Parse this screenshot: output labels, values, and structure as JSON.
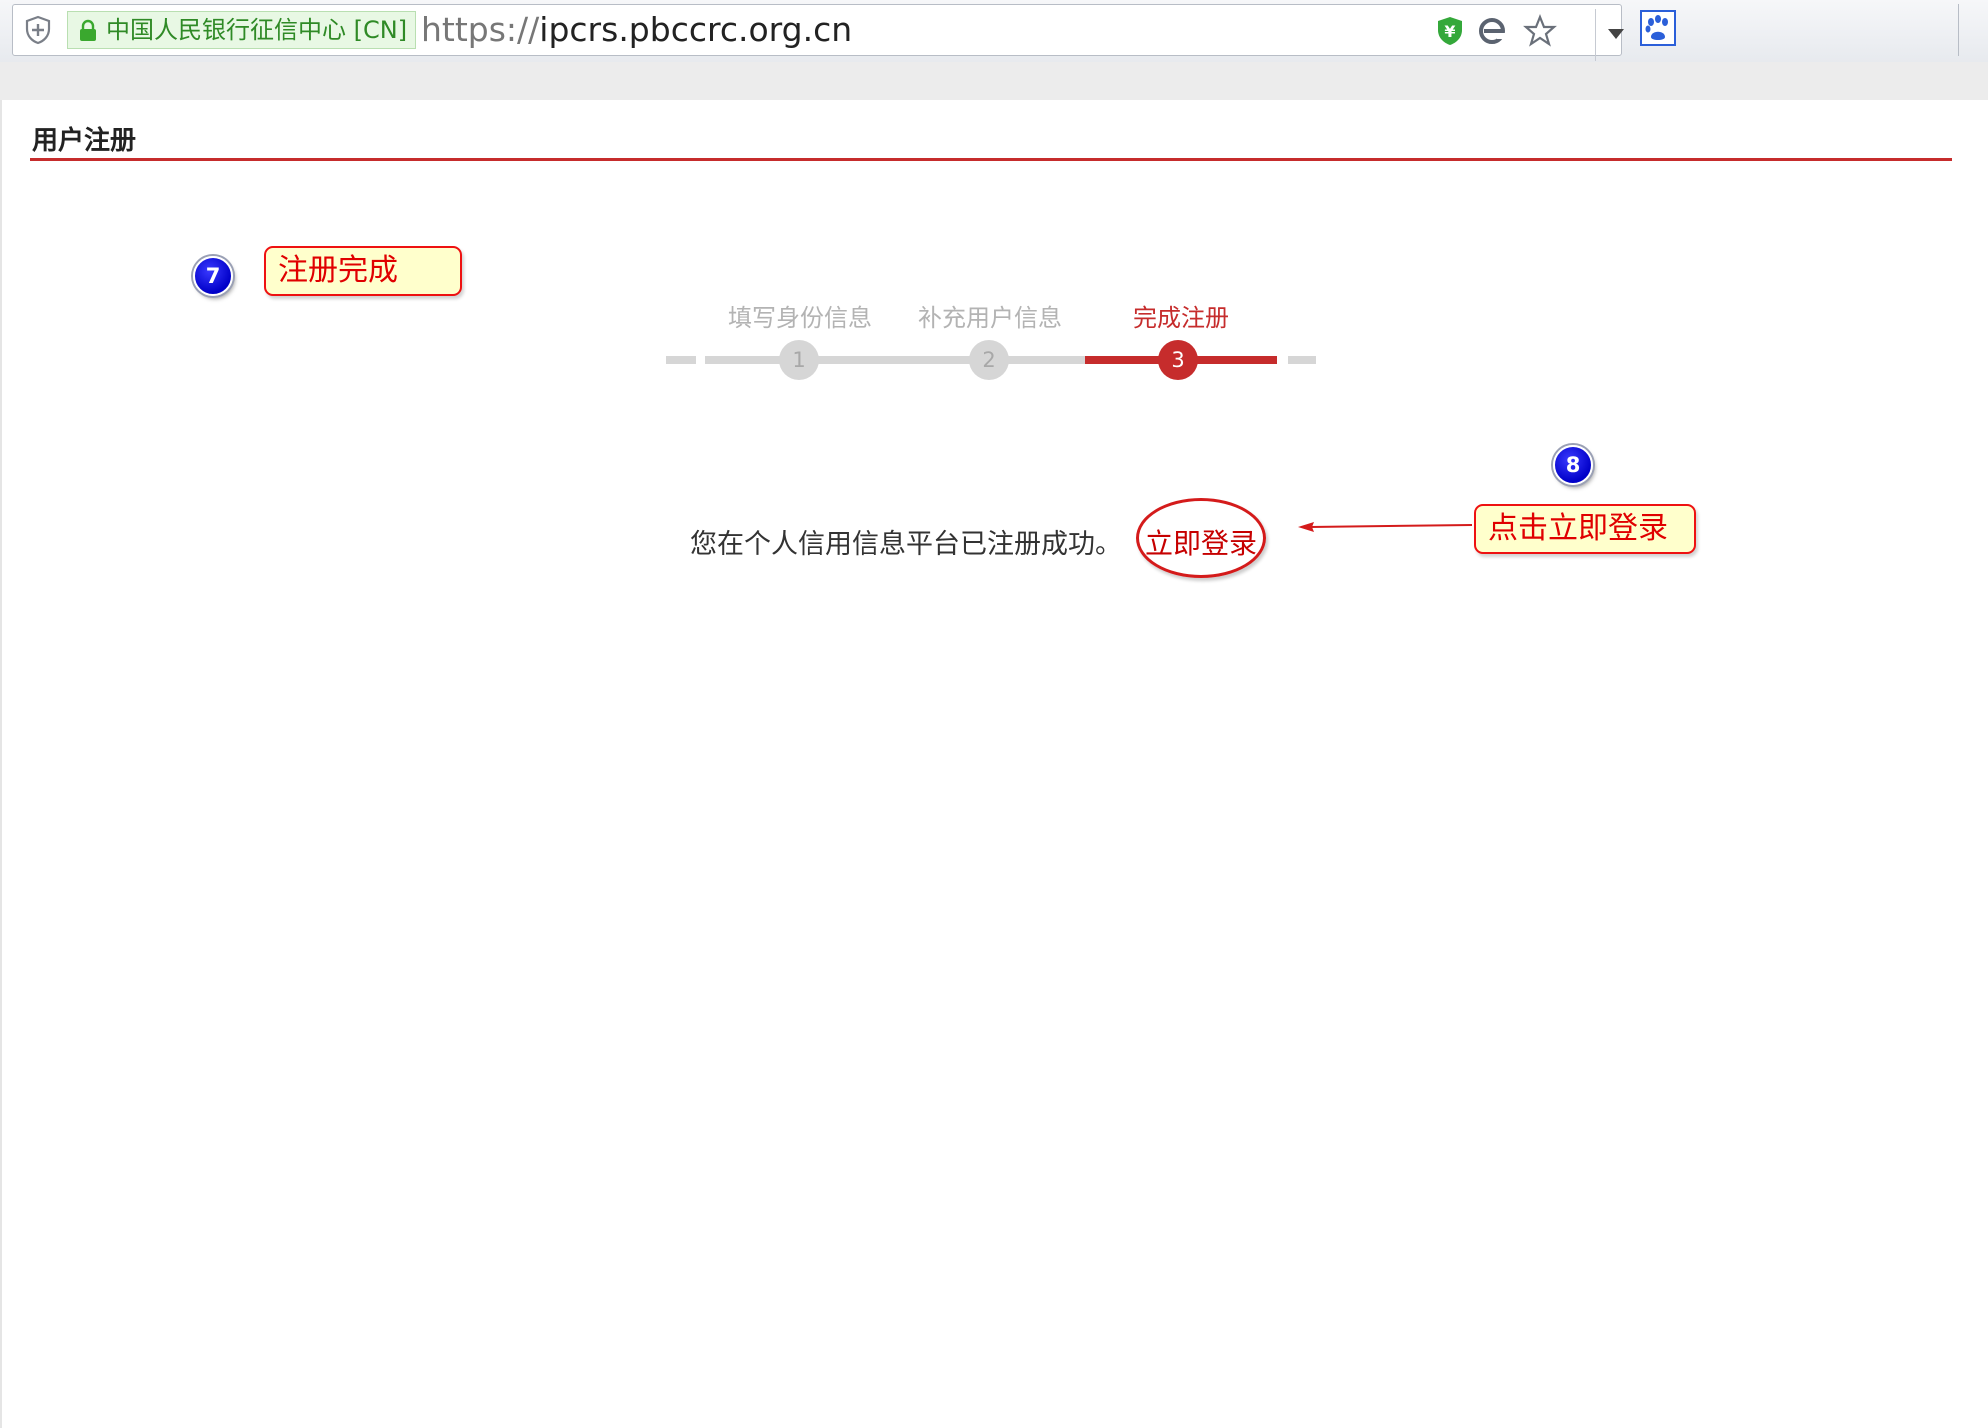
{
  "browser": {
    "site_identity": "中国人民银行征信中心 [CN]",
    "url_scheme": "https://",
    "url_host": "ipcrs.pbccrc.org.cn"
  },
  "page": {
    "title": "用户注册"
  },
  "steps": [
    {
      "label": "填写身份信息",
      "number": "1",
      "active": false
    },
    {
      "label": "补充用户信息",
      "number": "2",
      "active": false
    },
    {
      "label": "完成注册",
      "number": "3",
      "active": true
    }
  ],
  "message": {
    "text": "您在个人信用信息平台已注册成功。",
    "login_link": "立即登录"
  },
  "annotations": {
    "step7_number": "7",
    "step7_text": "注册完成",
    "step8_number": "8",
    "step8_text": "点击立即登录"
  },
  "colors": {
    "accent": "#c62c2c",
    "inactive": "#d6d6d6",
    "annotation_fill": "#ffffcc",
    "annotation_border": "#e11111",
    "badge": "#0000c8"
  },
  "icons": [
    "shield-icon",
    "lock-icon",
    "security-shield-icon",
    "ie-icon",
    "star-icon",
    "dropdown-icon",
    "baidu-paw-icon"
  ]
}
